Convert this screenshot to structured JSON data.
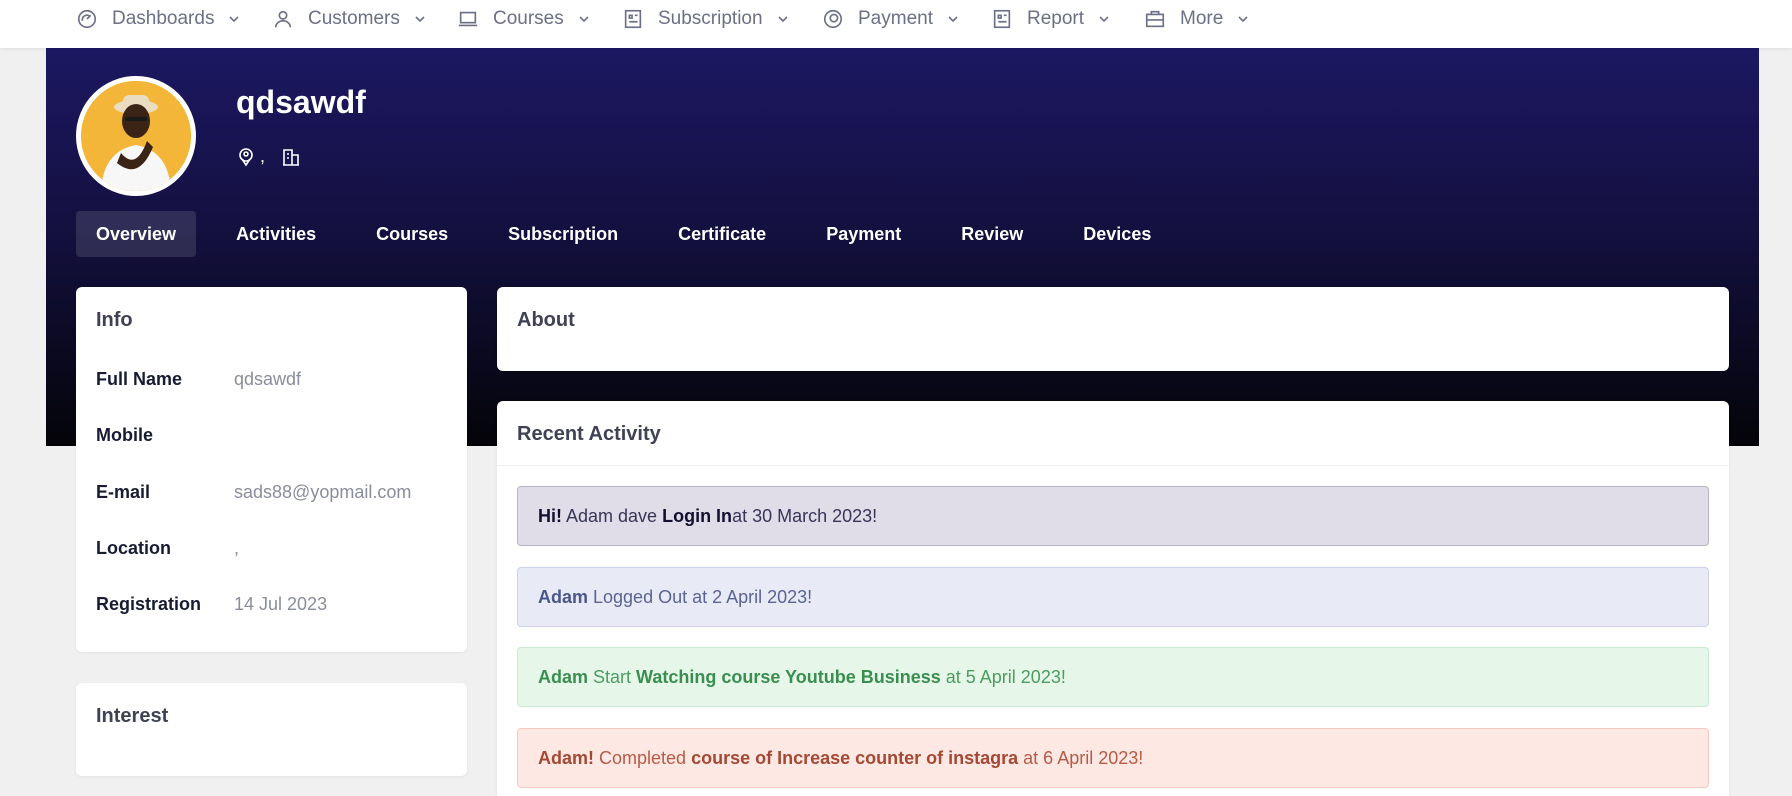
{
  "nav": [
    {
      "label": "Dashboards",
      "icon": "dashboard-icon"
    },
    {
      "label": "Customers",
      "icon": "user-icon"
    },
    {
      "label": "Courses",
      "icon": "laptop-icon"
    },
    {
      "label": "Subscription",
      "icon": "document-icon"
    },
    {
      "label": "Payment",
      "icon": "coins-icon"
    },
    {
      "label": "Report",
      "icon": "report-icon"
    },
    {
      "label": "More",
      "icon": "briefcase-icon"
    }
  ],
  "profile": {
    "name": "qdsawdf",
    "location_text": ","
  },
  "tabs": [
    "Overview",
    "Activities",
    "Courses",
    "Subscription",
    "Certificate",
    "Payment",
    "Review",
    "Devices"
  ],
  "active_tab": "Overview",
  "info": {
    "title": "Info",
    "rows": [
      {
        "key": "Full Name",
        "value": "qdsawdf"
      },
      {
        "key": "Mobile",
        "value": ""
      },
      {
        "key": "E-mail",
        "value": "sads88@yopmail.com"
      },
      {
        "key": "Location",
        "value": ","
      },
      {
        "key": "Registration",
        "value": "14 Jul 2023"
      }
    ]
  },
  "interest": {
    "title": "Interest"
  },
  "about": {
    "title": "About"
  },
  "activity": {
    "title": "Recent Activity",
    "items": [
      {
        "p1": "Hi!",
        "p2": " Adam dave ",
        "p3": "Login In",
        "p4": "at 30 March 2023!"
      },
      {
        "p1": "Adam",
        "p2": " Logged Out at 2 April 2023!",
        "p3": "",
        "p4": ""
      },
      {
        "p1": "Adam",
        "p2": " Start ",
        "p3": "Watching course Youtube Business",
        "p4": " at 5 April 2023!"
      },
      {
        "p1": "Adam!",
        "p2": " Completed ",
        "p3": "course of Increase counter of instagra",
        "p4": " at 6 April 2023!"
      }
    ]
  }
}
